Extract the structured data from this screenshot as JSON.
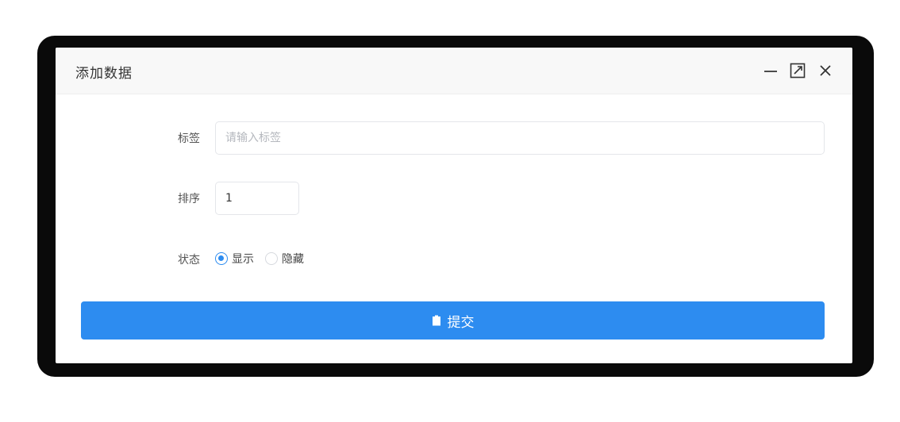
{
  "dialog": {
    "title": "添加数据"
  },
  "window_controls": {
    "minimize_icon": "minimize-icon",
    "maximize_icon": "maximize-icon",
    "close_icon": "close-icon"
  },
  "form": {
    "label_field": {
      "label": "标签",
      "placeholder": "请输入标签",
      "value": ""
    },
    "sort_field": {
      "label": "排序",
      "value": "1"
    },
    "status_field": {
      "label": "状态",
      "options": [
        {
          "label": "显示",
          "checked": true
        },
        {
          "label": "隐藏",
          "checked": false
        }
      ]
    }
  },
  "submit": {
    "label": "提交",
    "icon": "save-icon"
  },
  "colors": {
    "primary": "#2d8cf0",
    "frame": "#0a0a0a",
    "header_bg": "#f8f8f8"
  }
}
